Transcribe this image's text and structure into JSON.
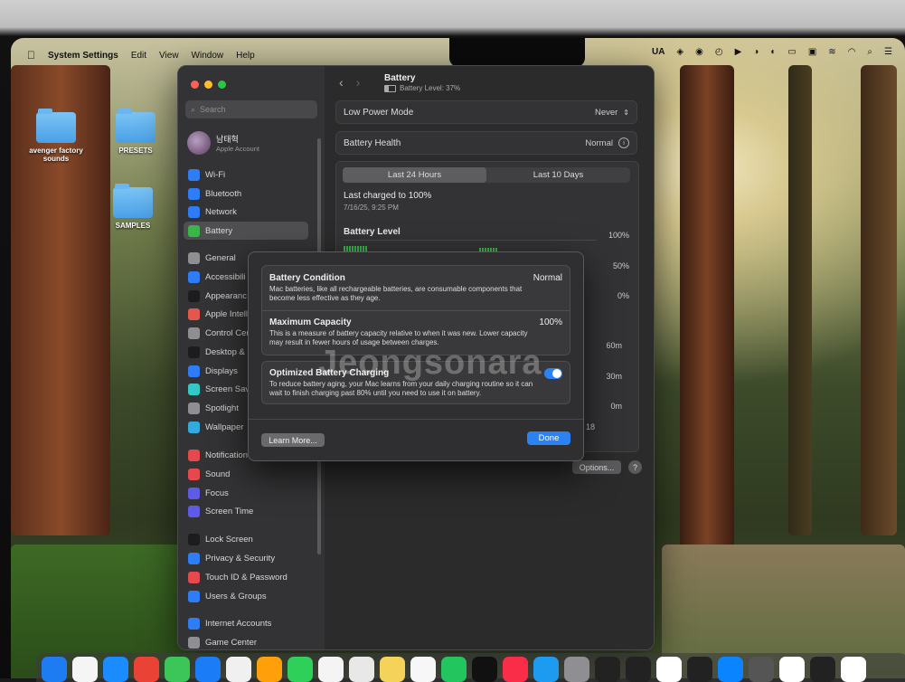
{
  "menubar": {
    "app": "System Settings",
    "items": [
      "Edit",
      "View",
      "Window",
      "Help"
    ],
    "status": [
      "UA"
    ]
  },
  "desktop": {
    "icons": [
      "avenger factory sounds",
      "PRESETS",
      "SAMPLES"
    ]
  },
  "sidebar": {
    "search_placeholder": "Search",
    "account_name": "남태혁",
    "account_sub": "Apple Account",
    "items": [
      {
        "label": "Wi-Fi",
        "icon": "wifi-icon",
        "color": "#2f7df6"
      },
      {
        "label": "Bluetooth",
        "icon": "bluetooth-icon",
        "color": "#2f7df6"
      },
      {
        "label": "Network",
        "icon": "globe-icon",
        "color": "#2f7df6"
      },
      {
        "label": "Battery",
        "icon": "battery-icon",
        "color": "#3ab54a"
      },
      {
        "label": "General",
        "icon": "gear-icon",
        "color": "#8e8e93"
      },
      {
        "label": "Accessibili",
        "icon": "accessibility-icon",
        "color": "#2f7df6"
      },
      {
        "label": "Appearanc",
        "icon": "appearance-icon",
        "color": "#1c1c1e"
      },
      {
        "label": "Apple Intell",
        "icon": "apple-intelligence-icon",
        "color": "#e3574d"
      },
      {
        "label": "Control Cen",
        "icon": "control-center-icon",
        "color": "#8e8e93"
      },
      {
        "label": "Desktop &",
        "icon": "desktop-dock-icon",
        "color": "#1c1c1e"
      },
      {
        "label": "Displays",
        "icon": "sun-icon",
        "color": "#2f7df6"
      },
      {
        "label": "Screen Sav",
        "icon": "screen-saver-icon",
        "color": "#34c7c7"
      },
      {
        "label": "Spotlight",
        "icon": "magnifier-icon",
        "color": "#8e8e93"
      },
      {
        "label": "Wallpaper",
        "icon": "wallpaper-icon",
        "color": "#34aadc"
      },
      {
        "label": "Notification",
        "icon": "bell-icon",
        "color": "#e5484d"
      },
      {
        "label": "Sound",
        "icon": "speaker-icon",
        "color": "#e5484d"
      },
      {
        "label": "Focus",
        "icon": "moon-icon",
        "color": "#5e5ce6"
      },
      {
        "label": "Screen Time",
        "icon": "hourglass-icon",
        "color": "#5e5ce6"
      },
      {
        "label": "Lock Screen",
        "icon": "lock-icon",
        "color": "#1c1c1e"
      },
      {
        "label": "Privacy & Security",
        "icon": "hand-icon",
        "color": "#2f7df6"
      },
      {
        "label": "Touch ID & Password",
        "icon": "fingerprint-icon",
        "color": "#e5484d"
      },
      {
        "label": "Users & Groups",
        "icon": "users-icon",
        "color": "#2f7df6"
      },
      {
        "label": "Internet Accounts",
        "icon": "at-icon",
        "color": "#2f7df6"
      },
      {
        "label": "Game Center",
        "icon": "game-center-icon",
        "color": "#8e8e93"
      }
    ]
  },
  "main": {
    "title": "Battery",
    "subtitle": "Battery Level: 37%",
    "low_power_label": "Low Power Mode",
    "low_power_value": "Never",
    "health_label": "Battery Health",
    "health_value": "Normal",
    "tabs": [
      "Last 24 Hours",
      "Last 10 Days"
    ],
    "last_charged": "Last charged to 100%",
    "last_charged_date": "7/16/25, 9:25 PM",
    "battery_level_label": "Battery Level",
    "y_ticks": [
      "100%",
      "50%",
      "0%"
    ],
    "usage_ticks": [
      "60m",
      "30m",
      "0m"
    ],
    "time_tick": "18",
    "options_label": "Options...",
    "help_label": "?"
  },
  "modal": {
    "condition_title": "Battery Condition",
    "condition_value": "Normal",
    "condition_desc": "Mac batteries, like all rechargeable batteries, are consumable components that become less effective as they age.",
    "capacity_title": "Maximum Capacity",
    "capacity_value": "100%",
    "capacity_desc": "This is a measure of battery capacity relative to when it was new. Lower capacity may result in fewer hours of usage between charges.",
    "optimized_title": "Optimized Battery Charging",
    "optimized_desc": "To reduce battery aging, your Mac learns from your daily charging routine so it can wait to finish charging past 80% until you need to use it on battery.",
    "learn_more": "Learn More...",
    "done": "Done"
  },
  "watermark": "Jeongsonara",
  "colors": {
    "accent": "#2b82f5",
    "battery_green": "#3ab54a"
  }
}
